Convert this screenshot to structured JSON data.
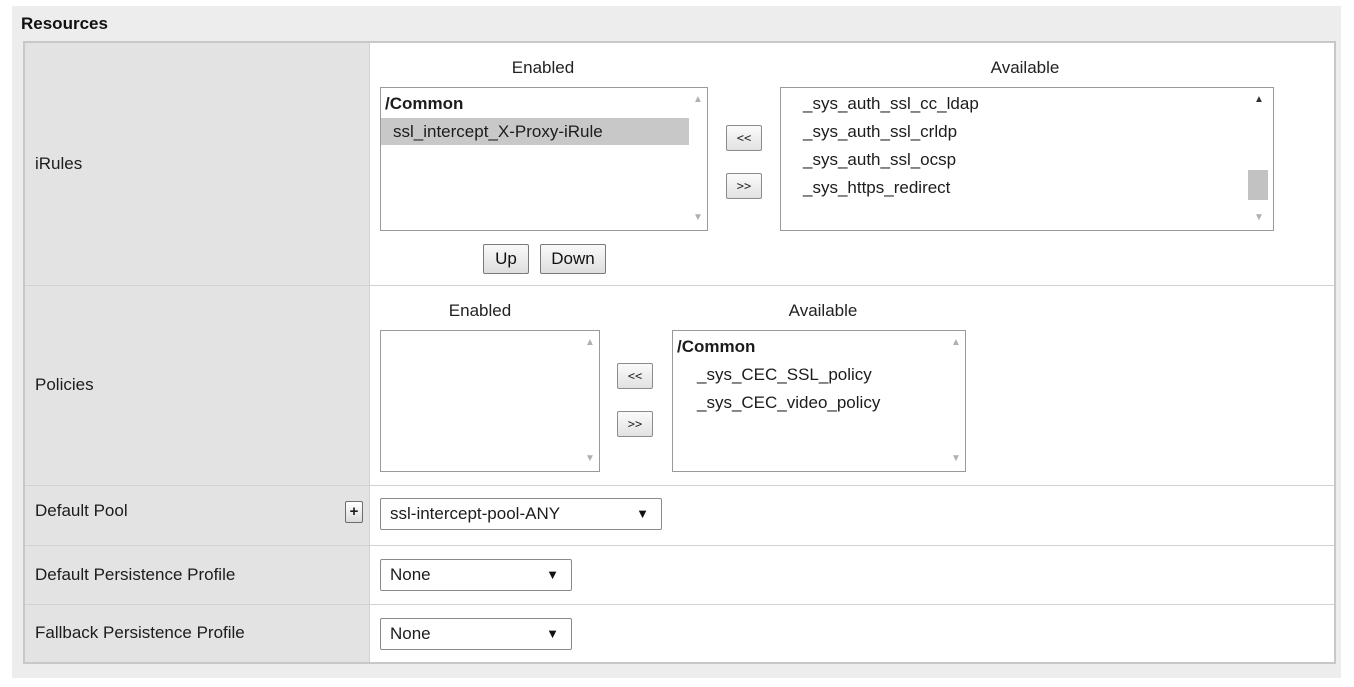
{
  "section": {
    "title": "Resources"
  },
  "irules": {
    "label": "iRules",
    "enabled_header": "Enabled",
    "available_header": "Available",
    "enabled_items": [
      {
        "text": "/Common",
        "group": true
      },
      {
        "text": "ssl_intercept_X-Proxy-iRule",
        "selected": true
      }
    ],
    "available_items": [
      "_sys_auth_ssl_cc_ldap",
      "_sys_auth_ssl_crldp",
      "_sys_auth_ssl_ocsp",
      "_sys_https_redirect"
    ],
    "move_left_label": "<<",
    "move_right_label": ">>",
    "up_label": "Up",
    "down_label": "Down"
  },
  "policies": {
    "label": "Policies",
    "enabled_header": "Enabled",
    "available_header": "Available",
    "available_items": [
      {
        "text": "/Common",
        "group": true
      },
      {
        "text": "_sys_CEC_SSL_policy"
      },
      {
        "text": "_sys_CEC_video_policy"
      }
    ],
    "move_left_label": "<<",
    "move_right_label": ">>"
  },
  "default_pool": {
    "label": "Default Pool",
    "plus_label": "+",
    "selected": "ssl-intercept-pool-ANY"
  },
  "default_persistence": {
    "label": "Default Persistence Profile",
    "selected": "None"
  },
  "fallback_persistence": {
    "label": "Fallback Persistence Profile",
    "selected": "None"
  },
  "icons": {
    "dropdown": "dropdown-arrow-icon",
    "scroll_up": "scroll-up-icon",
    "scroll_down": "scroll-down-icon"
  },
  "colors": {
    "label_bg": "#e3e3e3",
    "selected_bg": "#c8c8c8",
    "border": "#c8c8c8"
  }
}
